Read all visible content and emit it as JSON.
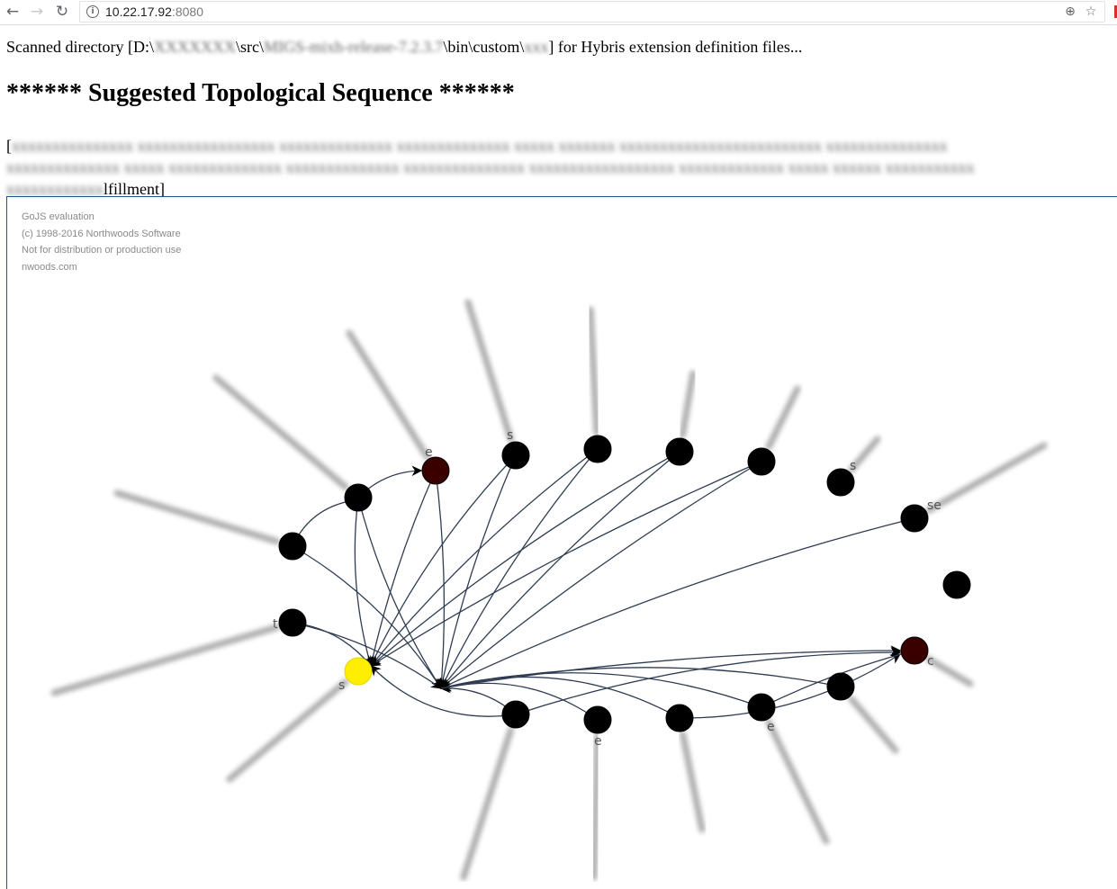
{
  "browser": {
    "url_host": "10.22.17.92",
    "url_port": ":8080",
    "back_glyph": "←",
    "forward_glyph": "→",
    "reload_glyph": "↻",
    "zoom_glyph": "⊕",
    "star_glyph": "☆",
    "info_glyph": "i"
  },
  "page": {
    "scan_prefix": "Scanned directory [D:\\",
    "scan_blur_1": "XXXXXXX",
    "scan_src": "\\src\\",
    "scan_blur_2": "MIGS-mixh-release-7.2.3.7",
    "scan_bin": "\\bin\\custom\\",
    "scan_blur_3": "xxx",
    "scan_suffix": "] for Hybris extension definition files...",
    "heading": "****** Suggested Topological Sequence ******",
    "sequence_open": "[",
    "sequence_blurred": "xxxxxxxxxxxxxxx xxxxxxxxxxxxxxxxx xxxxxxxxxxxxxx xxxxxxxxxxxxxx xxxxx xxxxxxx xxxxxxxxxxxxxxxxxxxxxxxxx xxxxxxxxxxxxxxx xxxxxxxxxxxxxx xxxxx xxxxxxxxxxxxxx xxxxxxxxxxxxxx xxxxxxxxxxxxxxx xxxxxxxxxxxxxxxxxx xxxxxxxxxxxxx xxxxx xxxxxx xxxxxxxxxxx xxxxxxxxxxxx",
    "sequence_close": "lfillment]"
  },
  "watermark": {
    "line1": "GoJS evaluation",
    "line2": "(c) 1998-2016 Northwoods Software",
    "line3": "Not for distribution or production use",
    "line4": "nwoods.com"
  },
  "colors": {
    "node_default": "#000000",
    "node_root": "#ffee00",
    "node_dark_red": "#3a0000",
    "link": "#2f3d52",
    "frame": "#2a4f8f"
  },
  "graph": {
    "nodes": [
      {
        "id": "n_yellow",
        "color": "root",
        "label_hint": "s"
      },
      {
        "id": "n1",
        "color": "default",
        "label_hint": ""
      },
      {
        "id": "n2",
        "color": "default",
        "label_hint": ""
      },
      {
        "id": "n3",
        "color": "dark_red",
        "label_hint": "e"
      },
      {
        "id": "n4",
        "color": "default",
        "label_hint": "s"
      },
      {
        "id": "n5",
        "color": "default",
        "label_hint": "s"
      },
      {
        "id": "n6",
        "color": "default",
        "label_hint": ""
      },
      {
        "id": "n7",
        "color": "default",
        "label_hint": ""
      },
      {
        "id": "n8",
        "color": "default",
        "label_hint": "s"
      },
      {
        "id": "n9",
        "color": "default",
        "label_hint": "se"
      },
      {
        "id": "n10",
        "color": "default",
        "label_hint": ""
      },
      {
        "id": "n11",
        "color": "dark_red",
        "label_hint": "c"
      },
      {
        "id": "n12",
        "color": "default",
        "label_hint": ""
      },
      {
        "id": "n13",
        "color": "default",
        "label_hint": "e"
      },
      {
        "id": "n14",
        "color": "default",
        "label_hint": ""
      },
      {
        "id": "n15",
        "color": "default",
        "label_hint": "e"
      },
      {
        "id": "n16",
        "color": "default",
        "label_hint": ""
      },
      {
        "id": "n17",
        "color": "default",
        "label_hint": "t"
      }
    ]
  }
}
